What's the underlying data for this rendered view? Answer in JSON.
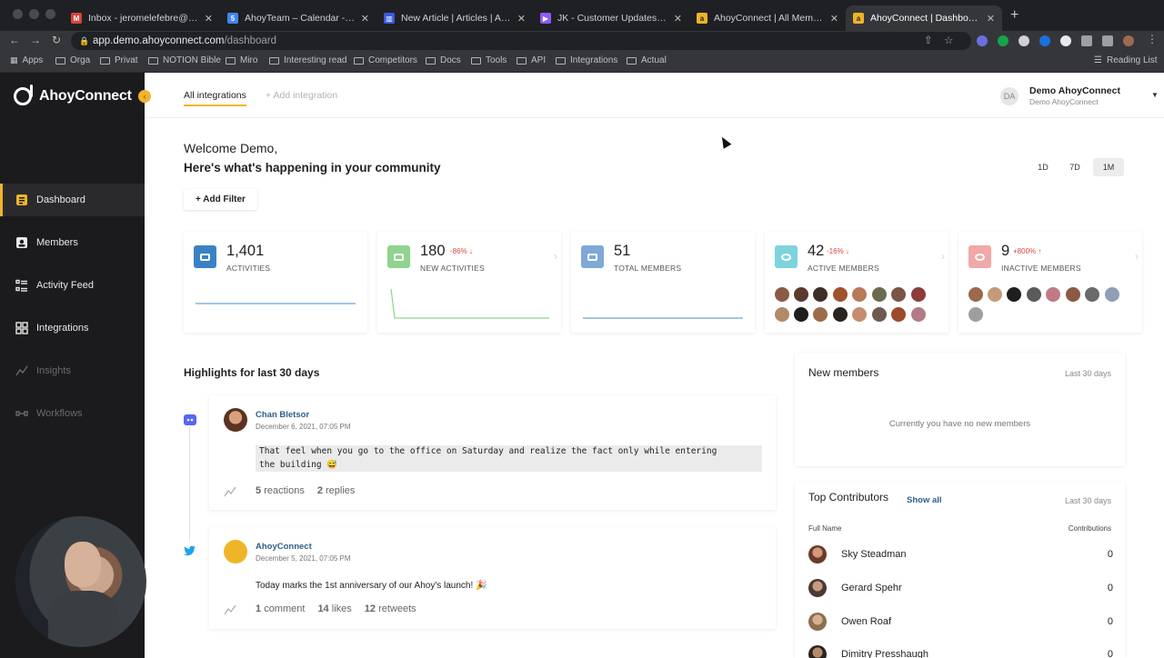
{
  "browser": {
    "tabs": [
      {
        "title": "Inbox - jeromelefebre@ahoyconnect.com",
        "icon": "gmail-icon",
        "color": "#d44638"
      },
      {
        "title": "AhoyTeam – Calendar - Week of",
        "icon": "calendar-icon",
        "color": "#4285f4"
      },
      {
        "title": "New Article | Articles | Articles",
        "icon": "articles-icon",
        "color": "#3b5bdb"
      },
      {
        "title": "JK - Customer Updates - Features",
        "icon": "figma-icon",
        "color": "#8b5cf6"
      },
      {
        "title": "AhoyConnect | All Members",
        "icon": "ahoy-icon",
        "color": "#f0b429"
      },
      {
        "title": "AhoyConnect | Dashboard",
        "icon": "ahoy-icon",
        "color": "#f0b429"
      }
    ],
    "url_host": "app.demo.ahoyconnect.com",
    "url_path": "/dashboard",
    "bookmarks": [
      "Apps",
      "Orga",
      "Privat",
      "NOTION Bible",
      "Miro",
      "Interesting read",
      "Competitors",
      "Docs",
      "Tools",
      "API",
      "Integrations",
      "Actual"
    ],
    "reading_list": "Reading List"
  },
  "sidebar": {
    "logo": "AhoyConnect",
    "items": [
      {
        "label": "Dashboard",
        "icon": "dashboard-icon",
        "active": true,
        "enabled": true
      },
      {
        "label": "Members",
        "icon": "members-icon",
        "active": false,
        "enabled": true
      },
      {
        "label": "Activity Feed",
        "icon": "activity-feed-icon",
        "active": false,
        "enabled": true
      },
      {
        "label": "Integrations",
        "icon": "integrations-icon",
        "active": false,
        "enabled": true
      },
      {
        "label": "Insights",
        "icon": "insights-icon",
        "active": false,
        "enabled": false
      },
      {
        "label": "Workflows",
        "icon": "workflows-icon",
        "active": false,
        "enabled": false
      }
    ]
  },
  "topnav": {
    "tabs": [
      "All integrations",
      "+ Add integration"
    ],
    "account_initials": "DA",
    "account_name": "Demo AhoyConnect",
    "account_sub": "Demo AhoyConnect"
  },
  "welcome": {
    "line1": "Welcome Demo,",
    "line2": "Here's what's happening in your community"
  },
  "ranges": [
    "1D",
    "7D",
    "1M"
  ],
  "active_range": "1M",
  "filter_label": "+ Add Filter",
  "stats": [
    {
      "value": "1,401",
      "label": "ACTIVITIES",
      "delta": "",
      "color": "#3b82c4"
    },
    {
      "value": "180",
      "label": "NEW ACTIVITIES",
      "delta": "-86% ↓",
      "color": "#8fd48f"
    },
    {
      "value": "51",
      "label": "TOTAL MEMBERS",
      "delta": "",
      "color": "#7ea8d6"
    },
    {
      "value": "42",
      "label": "ACTIVE MEMBERS",
      "delta": "-16% ↓",
      "color": "#7fd3dc"
    },
    {
      "value": "9",
      "label": "INACTIVE MEMBERS",
      "delta": "+800% ↑",
      "color": "#f0a8a8"
    }
  ],
  "highlights": {
    "title": "Highlights for last 30 days",
    "posts": [
      {
        "author": "Chan Bletsor",
        "date": "December 6, 2021, 07:05 PM",
        "source_icon": "discord-icon",
        "quote_line1": "That feel when you go to the office on Saturday and realize the fact only while entering",
        "quote_line2": "the building 😅",
        "stats": [
          {
            "n": "5",
            "label": "reactions"
          },
          {
            "n": "2",
            "label": "replies"
          }
        ]
      },
      {
        "author": "AhoyConnect",
        "date": "December 5, 2021, 07:05 PM",
        "source_icon": "twitter-icon",
        "text": "Today marks the 1st anniversary of our Ahoy's launch! 🎉",
        "stats": [
          {
            "n": "1",
            "label": "comment"
          },
          {
            "n": "14",
            "label": "likes"
          },
          {
            "n": "12",
            "label": "retweets"
          }
        ]
      }
    ]
  },
  "new_members": {
    "title": "New members",
    "period": "Last 30 days",
    "empty": "Currently you have no new members"
  },
  "top_contributors": {
    "title": "Top Contributors",
    "show_all": "Show all",
    "period": "Last 30 days",
    "col_name": "Full Name",
    "col_count": "Contributions",
    "rows": [
      {
        "name": "Sky Steadman",
        "count": "0"
      },
      {
        "name": "Gerard Spehr",
        "count": "0"
      },
      {
        "name": "Owen Roaf",
        "count": "0"
      },
      {
        "name": "Dimitry Presshaugh",
        "count": "0"
      }
    ]
  },
  "colors": {
    "accent": "#f0b429",
    "sidebar_bg": "#1b1b1d",
    "link": "#2f5f8a",
    "negative": "#d64545"
  }
}
